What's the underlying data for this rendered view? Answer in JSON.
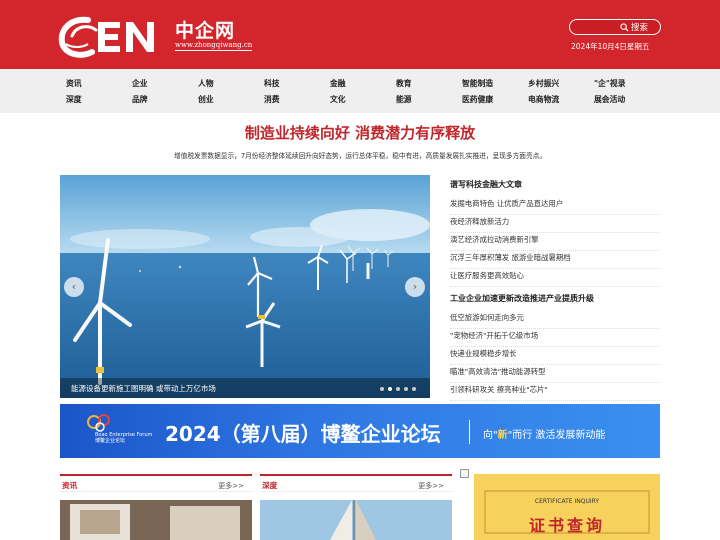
{
  "header": {
    "logo_cn": "中企网",
    "logo_url": "www.zhongqiwang.cn",
    "search_label": "搜索",
    "search_placeholder": "",
    "date": "2024年10月4日星期五"
  },
  "nav": [
    [
      "资讯",
      "深度"
    ],
    [
      "企业",
      "品牌"
    ],
    [
      "人物",
      "创业"
    ],
    [
      "科技",
      "消费"
    ],
    [
      "金融",
      "文化"
    ],
    [
      "教育",
      "能源"
    ],
    [
      "智能制造",
      "医药健康"
    ],
    [
      "乡村振兴",
      "电商物流"
    ],
    [
      "\"企\"视录",
      "展会活动"
    ]
  ],
  "headline": {
    "title": "制造业持续向好 消费潜力有序释放",
    "summary": "增值税发票数据显示，7月份经济整体延续回升向好态势，运行总体平稳，稳中有进，高质量发展扎实推进，呈现多方面亮点。"
  },
  "slider": {
    "caption": "能源设备更新施工图明确 或带动上万亿市场",
    "prev": "‹",
    "next": "›"
  },
  "news": {
    "group1_title": "谱写科技金融大文章",
    "group1": [
      "发掘电商特色 让优质产品直达用户",
      "夜经济释放新活力",
      "演艺经济成拉动消费新引擎",
      "沉浮三年厚积薄发 旅游业暗战暑期档",
      "让医疗服务更高效贴心"
    ],
    "group2_title": "工业企业加速更新改造推进产业提质升级",
    "group2": [
      "低空旅游如何走向多元",
      "\"宠物经济\"开拓千亿级市场",
      "快递业规模稳步增长",
      "瞄准\"高效清洁\"推动能源转型",
      "引领科研攻关 擦亮种业\"芯片\""
    ]
  },
  "banner": {
    "logo_en": "Boao Enterprise Forum",
    "logo_cn": "博鳌企业论坛",
    "main": "2024（第八届）博鳌企业论坛",
    "slogan_a": "向\"",
    "slogan_b": "新",
    "slogan_c": "\"而行  激活发展新动能"
  },
  "sections": {
    "s1_title": "资讯",
    "s1_more": "更多>>",
    "s2_title": "深度",
    "s2_more": "更多>>"
  },
  "cert": {
    "en": "CERTIFICATE INQUIRY",
    "cn": "证书查询"
  },
  "colors": {
    "brand_red": "#d3262c",
    "nav_bg": "#efefef",
    "banner_blue": "#2f78e3",
    "cert_yellow": "#f6d15c"
  }
}
